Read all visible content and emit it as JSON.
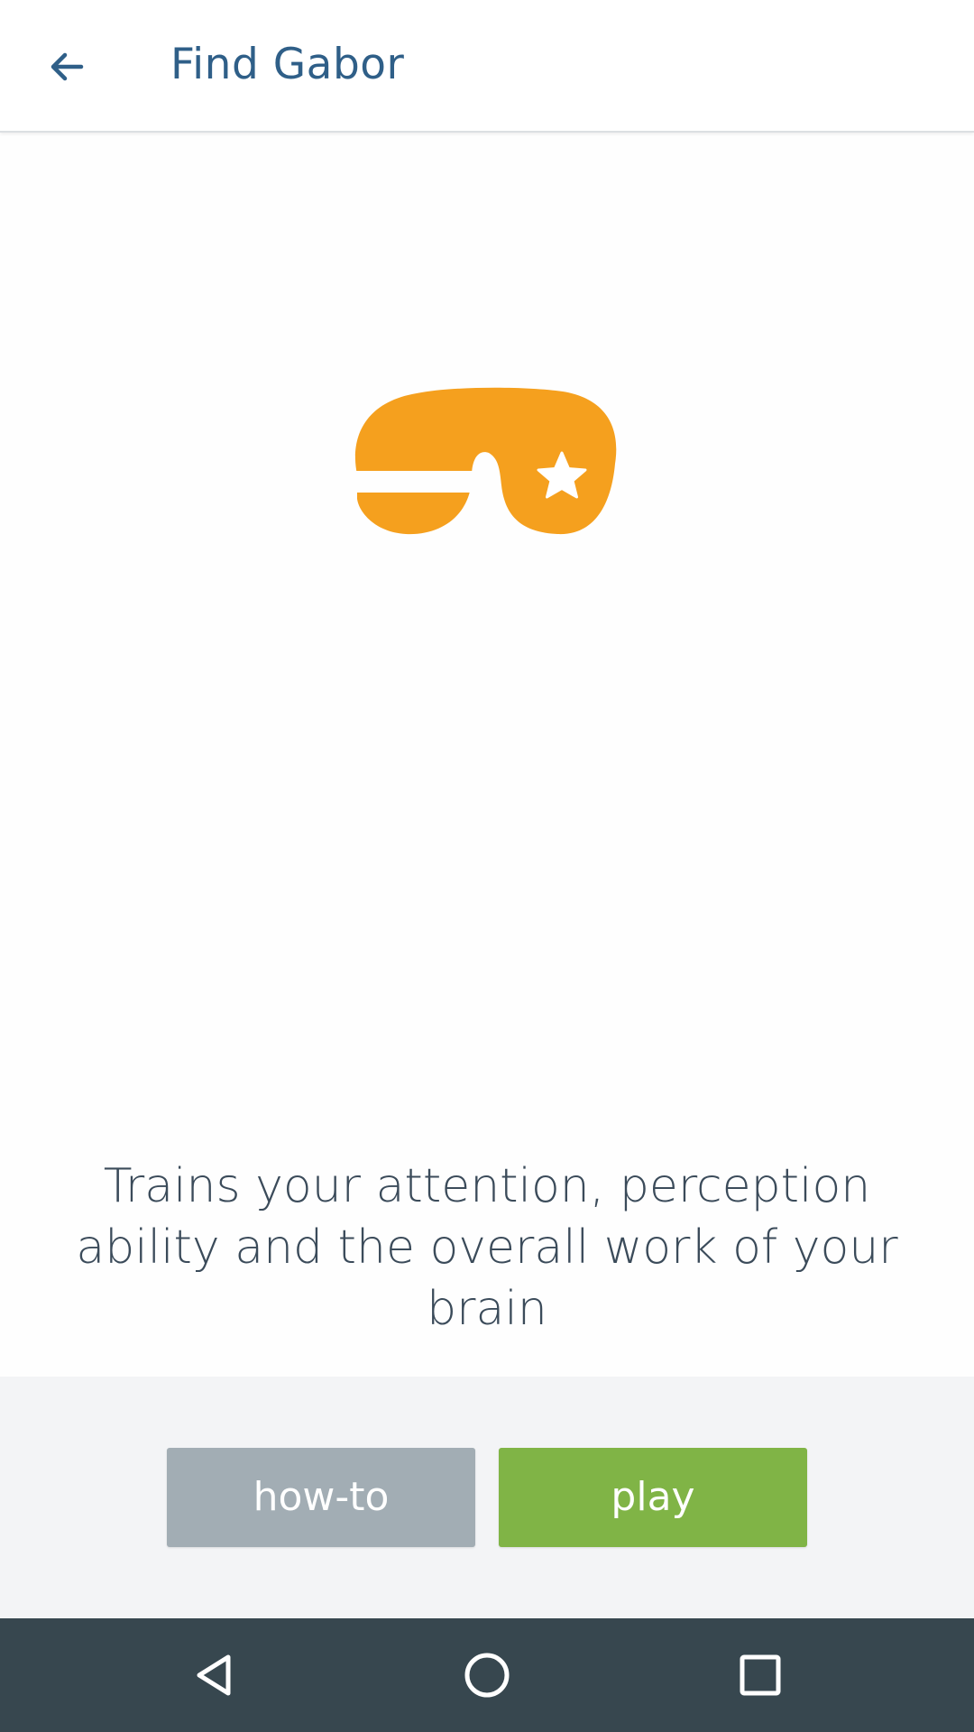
{
  "app_bar": {
    "title": "Find Gabor",
    "back_icon": "arrow-left-icon"
  },
  "hero": {
    "icon": "eye-mask-icon",
    "icon_color": "#f5a01e",
    "description": "Trains your attention, perception ability and the overall work of your brain"
  },
  "actions": {
    "howto_label": "how-to",
    "play_label": "play",
    "howto_color": "#a2adb4",
    "play_color": "#80b446"
  },
  "colors": {
    "title": "#2f5f88",
    "nav_bar": "#37474f",
    "panel": "#f3f4f6"
  },
  "system_nav": {
    "back_icon": "nav-back-icon",
    "home_icon": "nav-home-icon",
    "recents_icon": "nav-recents-icon"
  }
}
